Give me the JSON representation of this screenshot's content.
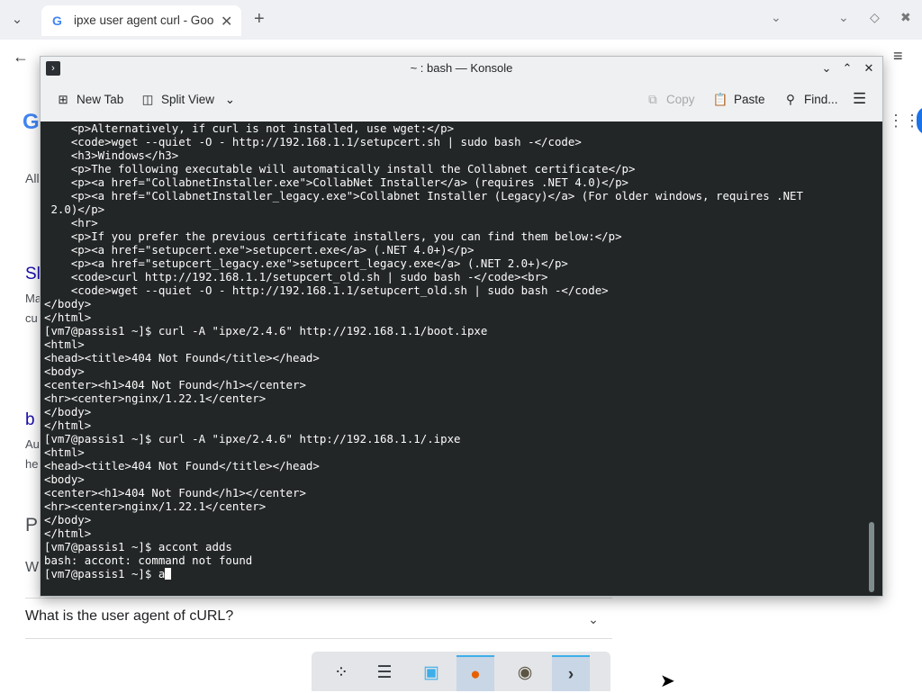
{
  "browser": {
    "tab_title": "ipxe user agent curl - Goo",
    "tab_favicon": "G",
    "new_tab_label": "+",
    "back_label": "←",
    "menu_label": "≡"
  },
  "page": {
    "logo_peek": "G",
    "faq_question": "What is the user agent of cURL?",
    "left_peeks": [
      "All",
      "Sl",
      "Ma",
      "cu",
      "b",
      "Au",
      "he",
      "P",
      "W"
    ]
  },
  "konsole": {
    "title": "~ : bash — Konsole",
    "toolbar": {
      "new_tab": "New Tab",
      "split_view": "Split View",
      "copy": "Copy",
      "paste": "Paste",
      "find": "Find..."
    },
    "terminal_text": "    <p>Alternatively, if curl is not installed, use wget:</p>\n    <code>wget --quiet -O - http://192.168.1.1/setupcert.sh | sudo bash -</code>\n    <h3>Windows</h3>\n    <p>The following executable will automatically install the Collabnet certificate</p>\n    <p><a href=\"CollabnetInstaller.exe\">CollabNet Installer</a> (requires .NET 4.0)</p>\n    <p><a href=\"CollabnetInstaller_legacy.exe\">Collabnet Installer (Legacy)</a> (For older windows, requires .NET\n 2.0)</p>\n    <hr>\n    <p>If you prefer the previous certificate installers, you can find them below:</p>\n    <p><a href=\"setupcert.exe\">setupcert.exe</a> (.NET 4.0+)</p>\n    <p><a href=\"setupcert_legacy.exe\">setupcert_legacy.exe</a> (.NET 2.0+)</p>\n    <code>curl http://192.168.1.1/setupcert_old.sh | sudo bash -</code><br>\n    <code>wget --quiet -O - http://192.168.1.1/setupcert_old.sh | sudo bash -</code>\n</body>\n</html>\n[vm7@passis1 ~]$ curl -A \"ipxe/2.4.6\" http://192.168.1.1/boot.ipxe\n<html>\n<head><title>404 Not Found</title></head>\n<body>\n<center><h1>404 Not Found</h1></center>\n<hr><center>nginx/1.22.1</center>\n</body>\n</html>\n[vm7@passis1 ~]$ curl -A \"ipxe/2.4.6\" http://192.168.1.1/.ipxe\n<html>\n<head><title>404 Not Found</title></head>\n<body>\n<center><h1>404 Not Found</h1></center>\n<hr><center>nginx/1.22.1</center>\n</body>\n</html>\n[vm7@passis1 ~]$ accont adds\nbash: accont: command not found\n[vm7@passis1 ~]$ a"
  },
  "taskbar": {
    "items": [
      {
        "icon": "app-launcher-icon",
        "glyph": "⁘"
      },
      {
        "icon": "system-settings-icon",
        "glyph": "☰"
      },
      {
        "icon": "discover-store-icon",
        "glyph": "▣"
      },
      {
        "icon": "firefox-icon",
        "glyph": "●"
      },
      {
        "icon": "gimp-icon",
        "glyph": "◉"
      },
      {
        "icon": "konsole-icon",
        "glyph": "›"
      }
    ]
  },
  "colors": {
    "terminal_bg": "#232627",
    "terminal_fg": "#fcfcfc",
    "accent": "#3daee9"
  }
}
